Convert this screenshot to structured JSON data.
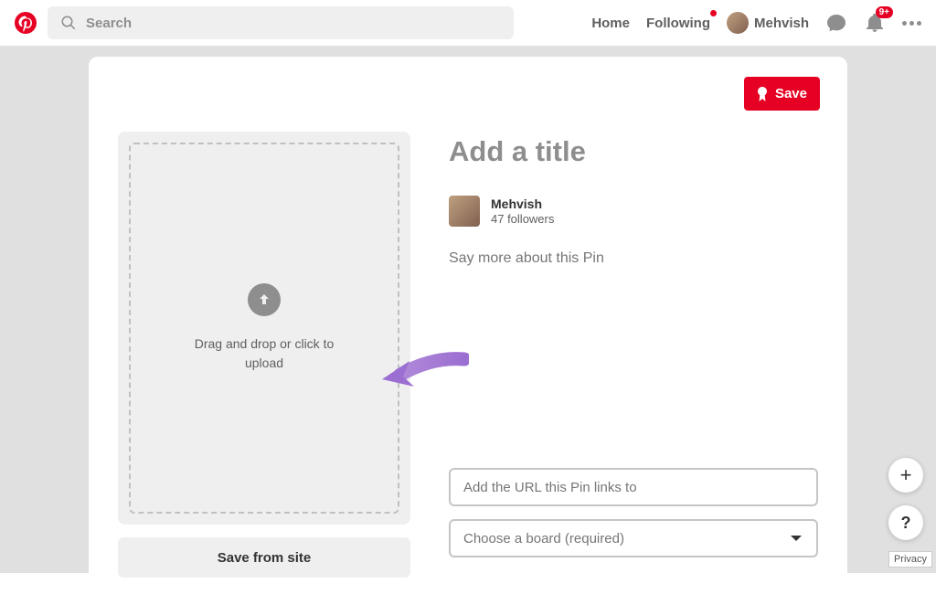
{
  "nav": {
    "search_placeholder": "Search",
    "home": "Home",
    "following": "Following",
    "username": "Mehvish",
    "notification_badge": "9+"
  },
  "builder": {
    "save_label": "Save",
    "upload_text": "Drag and drop or click to upload",
    "save_from_site": "Save from site",
    "title_placeholder": "Add a title",
    "author_name": "Mehvish",
    "followers_text": "47 followers",
    "desc_placeholder": "Say more about this Pin",
    "url_placeholder": "Add the URL this Pin links to",
    "board_placeholder": "Choose a board (required)"
  },
  "footer": {
    "privacy": "Privacy"
  }
}
